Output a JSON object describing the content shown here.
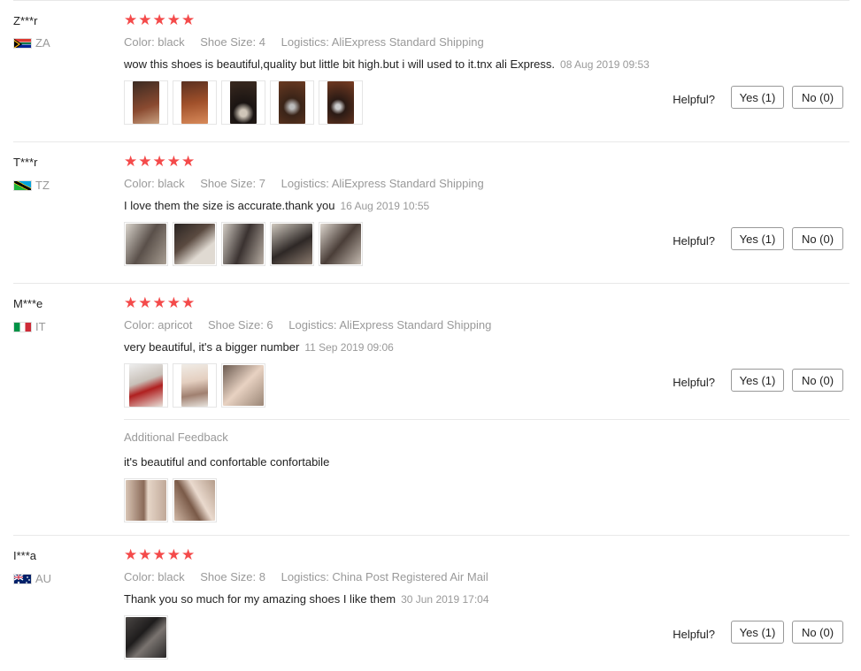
{
  "labels": {
    "helpful": "Helpful?",
    "additional_feedback": "Additional Feedback"
  },
  "reviews": [
    {
      "user": "Z***r",
      "country": "ZA",
      "stars": "★★★★★",
      "color": "Color: black",
      "size": "Shoe Size: 4",
      "logistics": "Logistics: AliExpress Standard Shipping",
      "text": "wow this shoes is beautiful,quality but little bit high.but i will used to it.tnx ali Express.",
      "date": "08 Aug 2019 09:53",
      "yes": "Yes (1)",
      "no": "No (0)"
    },
    {
      "user": "T***r",
      "country": "TZ",
      "stars": "★★★★★",
      "color": "Color: black",
      "size": "Shoe Size: 7",
      "logistics": "Logistics: AliExpress Standard Shipping",
      "text": "I love them the size is accurate.thank you",
      "date": "16 Aug 2019 10:55",
      "yes": "Yes (1)",
      "no": "No (0)"
    },
    {
      "user": "M***e",
      "country": "IT",
      "stars": "★★★★★",
      "color": "Color: apricot",
      "size": "Shoe Size: 6",
      "logistics": "Logistics: AliExpress Standard Shipping",
      "text": "very beautiful, it's a bigger number",
      "date": "11 Sep 2019 09:06",
      "yes": "Yes (1)",
      "no": "No (0)",
      "additional_text": "it's beautiful and confortable confortabile"
    },
    {
      "user": "I***a",
      "country": "AU",
      "stars": "★★★★★",
      "color": "Color: black",
      "size": "Shoe Size: 8",
      "logistics": "Logistics: China Post Registered Air Mail",
      "text": "Thank you so much for my amazing shoes I like them",
      "date": "30 Jun 2019 17:04",
      "yes": "Yes (1)",
      "no": "No (0)"
    }
  ],
  "colors": {
    "star": "#f44a4a",
    "muted": "#999999",
    "separator": "#e8e8e8"
  }
}
